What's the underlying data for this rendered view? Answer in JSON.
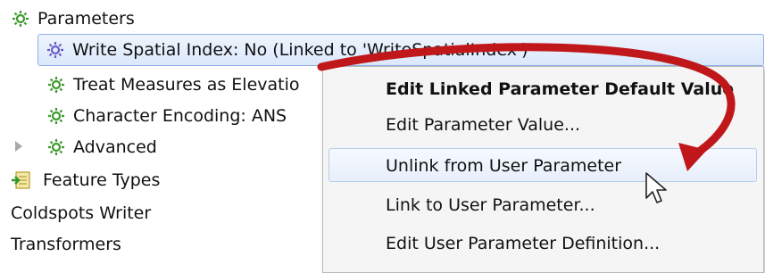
{
  "tree": {
    "parameters": "Parameters",
    "write_spatial_index": "Write Spatial Index: No (Linked to 'WriteSpatialIndex')",
    "treat_measures": "Treat Measures as Elevatio",
    "character_encoding": "Character Encoding: ANS",
    "advanced": "Advanced",
    "feature_types": "Feature Types",
    "coldspots_writer": "Coldspots Writer",
    "transformers": "Transformers"
  },
  "context_menu": {
    "edit_linked_default": "Edit Linked Parameter Default Value",
    "edit_param_value": "Edit Parameter Value...",
    "unlink": "Unlink from User Parameter",
    "link": "Link to User Parameter...",
    "edit_user_param_def": "Edit User Parameter Definition..."
  },
  "colors": {
    "gear_green": "#3d9a2d",
    "gear_purple": "#6a5bc4",
    "arrow_red": "#c0171a",
    "selection_border": "#8fb0e6"
  },
  "icons": [
    "gear-icon",
    "expander-triangle-icon",
    "feature-types-icon",
    "mouse-cursor-icon",
    "red-arrow-annotation"
  ]
}
